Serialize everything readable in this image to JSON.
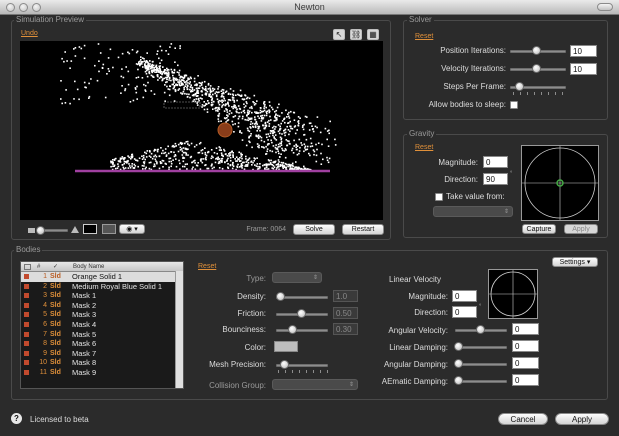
{
  "window": {
    "title": "Newton"
  },
  "preview": {
    "group_title": "Simulation Preview",
    "undo": "Undo",
    "frame_label": "Frame: 0064",
    "solve": "Solve",
    "restart": "Restart",
    "eye_menu": "▾"
  },
  "solver": {
    "group_title": "Solver",
    "reset": "Reset",
    "position_iterations_label": "Position Iterations:",
    "position_iterations": "10",
    "velocity_iterations_label": "Velocity Iterations:",
    "velocity_iterations": "10",
    "steps_per_frame_label": "Steps Per Frame:",
    "allow_sleep_label": "Allow bodies to sleep:"
  },
  "gravity": {
    "group_title": "Gravity",
    "reset": "Reset",
    "magnitude_label": "Magnitude:",
    "magnitude": "0",
    "direction_label": "Direction:",
    "direction": "90",
    "take_value_label": "Take value from:",
    "capture": "Capture",
    "apply": "Apply"
  },
  "bodies": {
    "group_title": "Bodies",
    "settings": "Settings ▾",
    "reset": "Reset",
    "columns": [
      "#",
      "✓",
      "Body Name"
    ],
    "rows": [
      {
        "num": "1",
        "type": "Sld",
        "name": "Orange Solid 1",
        "selected": true
      },
      {
        "num": "2",
        "type": "Sld",
        "name": "Medium Royal Blue Solid 1"
      },
      {
        "num": "3",
        "type": "Sld",
        "name": "Mask 1"
      },
      {
        "num": "4",
        "type": "Sld",
        "name": "Mask 2"
      },
      {
        "num": "5",
        "type": "Sld",
        "name": "Mask 3"
      },
      {
        "num": "6",
        "type": "Sld",
        "name": "Mask 4"
      },
      {
        "num": "7",
        "type": "Sld",
        "name": "Mask 5"
      },
      {
        "num": "8",
        "type": "Sld",
        "name": "Mask 6"
      },
      {
        "num": "9",
        "type": "Sld",
        "name": "Mask 7"
      },
      {
        "num": "10",
        "type": "Sld",
        "name": "Mask 8"
      },
      {
        "num": "11",
        "type": "Sld",
        "name": "Mask 9"
      }
    ],
    "props": {
      "type_label": "Type:",
      "density_label": "Density:",
      "density": "1.0",
      "friction_label": "Friction:",
      "friction": "0.50",
      "bounciness_label": "Bounciness:",
      "bounciness": "0.30",
      "color_label": "Color:",
      "mesh_precision_label": "Mesh Precision:",
      "collision_group_label": "Collision Group:"
    },
    "velocity": {
      "linear_velocity_label": "Linear Velocity",
      "magnitude_label": "Magnitude:",
      "magnitude": "0",
      "direction_label": "Direction:",
      "direction": "0",
      "angular_velocity_label": "Angular Velocity:",
      "angular_velocity": "0",
      "linear_damping_label": "Linear Damping:",
      "linear_damping": "0",
      "angular_damping_label": "Angular Damping:",
      "angular_damping": "0",
      "aematic_damping_label": "AEmatic Damping:",
      "aematic_damping": "0"
    }
  },
  "footer": {
    "license": "Licensed to beta",
    "cancel": "Cancel",
    "apply": "Apply"
  },
  "colors": {
    "accent": "#e0903a",
    "swatch": "#c24a2e",
    "floor": "#a040a0",
    "crosshair": "#44aa44"
  }
}
